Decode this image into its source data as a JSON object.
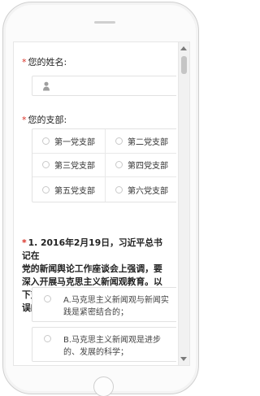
{
  "form": {
    "name_label": "您的姓名:",
    "branch_label": "您的支部:",
    "required_mark": "*",
    "branches": [
      "第一党支部",
      "第二党支部",
      "第三党支部",
      "第四党支部",
      "第五党支部",
      "第六党支部"
    ],
    "question": {
      "text": "1. 2016年2月19日，习近平总书记在\n党的新闻舆论工作座谈会上强调，要\n深入开展马克思主义新闻观教育。以\n下对马克思主义新闻观的理解中，错\n误的是( )。",
      "options": [
        "A.马克思主义新闻观与新闻实\n践是紧密结合的；",
        "B.马克思主义新闻观是进步\n的、发展的科学；"
      ]
    }
  },
  "icons": {
    "user_icon": "user-icon",
    "scroll_up": "scroll-up-arrow-icon",
    "scroll_down": "scroll-down-arrow-icon"
  },
  "colors": {
    "required": "#d93025",
    "border": "#e2e2e2",
    "text": "#222222"
  }
}
